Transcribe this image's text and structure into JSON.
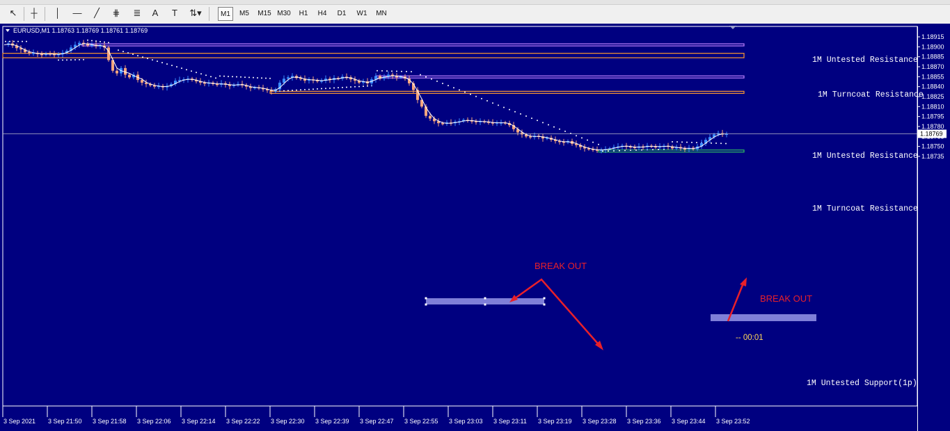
{
  "toolbar": {
    "tools": [
      {
        "name": "cursor-arrow-icon",
        "glyph": "↖"
      },
      {
        "name": "crosshair-icon",
        "glyph": "┼"
      },
      {
        "name": "vertical-line-icon",
        "glyph": "│"
      },
      {
        "name": "horizontal-line-icon",
        "glyph": "—"
      },
      {
        "name": "trendline-icon",
        "glyph": "╱"
      },
      {
        "name": "equidistant-channel-icon",
        "glyph": "⋕"
      },
      {
        "name": "fibonacci-icon",
        "glyph": "≣"
      },
      {
        "name": "text-icon",
        "glyph": "A"
      },
      {
        "name": "text-label-icon",
        "glyph": "T"
      },
      {
        "name": "shapes-dropdown-icon",
        "glyph": "⇅▾"
      }
    ],
    "timeframes": [
      "M1",
      "M5",
      "M15",
      "M30",
      "H1",
      "H4",
      "D1",
      "W1",
      "MN"
    ],
    "active_timeframe": "M1"
  },
  "chart": {
    "header": "EURUSD,M1  1.18763 1.18769 1.18761 1.18769",
    "current_price": "1.18769",
    "countdown": "-- 00:01",
    "colors": {
      "background": "#000080",
      "bull": "#3b8dff",
      "bear": "#f4a57e",
      "text": "#ffffff",
      "annotation": "#e8202a"
    },
    "price_axis": [
      "1.18915",
      "1.18900",
      "1.18885",
      "1.18870",
      "1.18855",
      "1.18840",
      "1.18825",
      "1.18810",
      "1.18795",
      "1.18780",
      "1.18765",
      "1.18750",
      "1.18735"
    ],
    "time_axis": [
      "3 Sep 2021",
      "3 Sep 21:50",
      "3 Sep 21:58",
      "3 Sep 22:06",
      "3 Sep 22:14",
      "3 Sep 22:22",
      "3 Sep 22:30",
      "3 Sep 22:39",
      "3 Sep 22:47",
      "3 Sep 22:55",
      "3 Sep 23:03",
      "3 Sep 23:11",
      "3 Sep 23:19",
      "3 Sep 23:28",
      "3 Sep 23:36",
      "3 Sep 23:44",
      "3 Sep 23:52"
    ],
    "levels": [
      {
        "label": "1M Untested Resistance",
        "color": "#c080ff",
        "top": 1.189045,
        "bottom": 1.189015
      },
      {
        "label": "1M Turncoat Resistance",
        "color": "#ff9a30",
        "top": 1.188902,
        "bottom": 1.188835
      },
      {
        "label": "1M Untested Resistance",
        "color": "#c080ff",
        "top": 1.188562,
        "bottom": 1.188538
      },
      {
        "label": "1M Turncoat Resistance",
        "color": "#ff9a30",
        "top": 1.18833,
        "bottom": 1.18831
      },
      {
        "label": "1M Untested Support(1p)",
        "color": "#30c060",
        "top": 1.187446,
        "bottom": 1.18743
      }
    ],
    "annotations": [
      {
        "label": "BREAK OUT"
      },
      {
        "label": "BREAK OUT"
      }
    ]
  }
}
